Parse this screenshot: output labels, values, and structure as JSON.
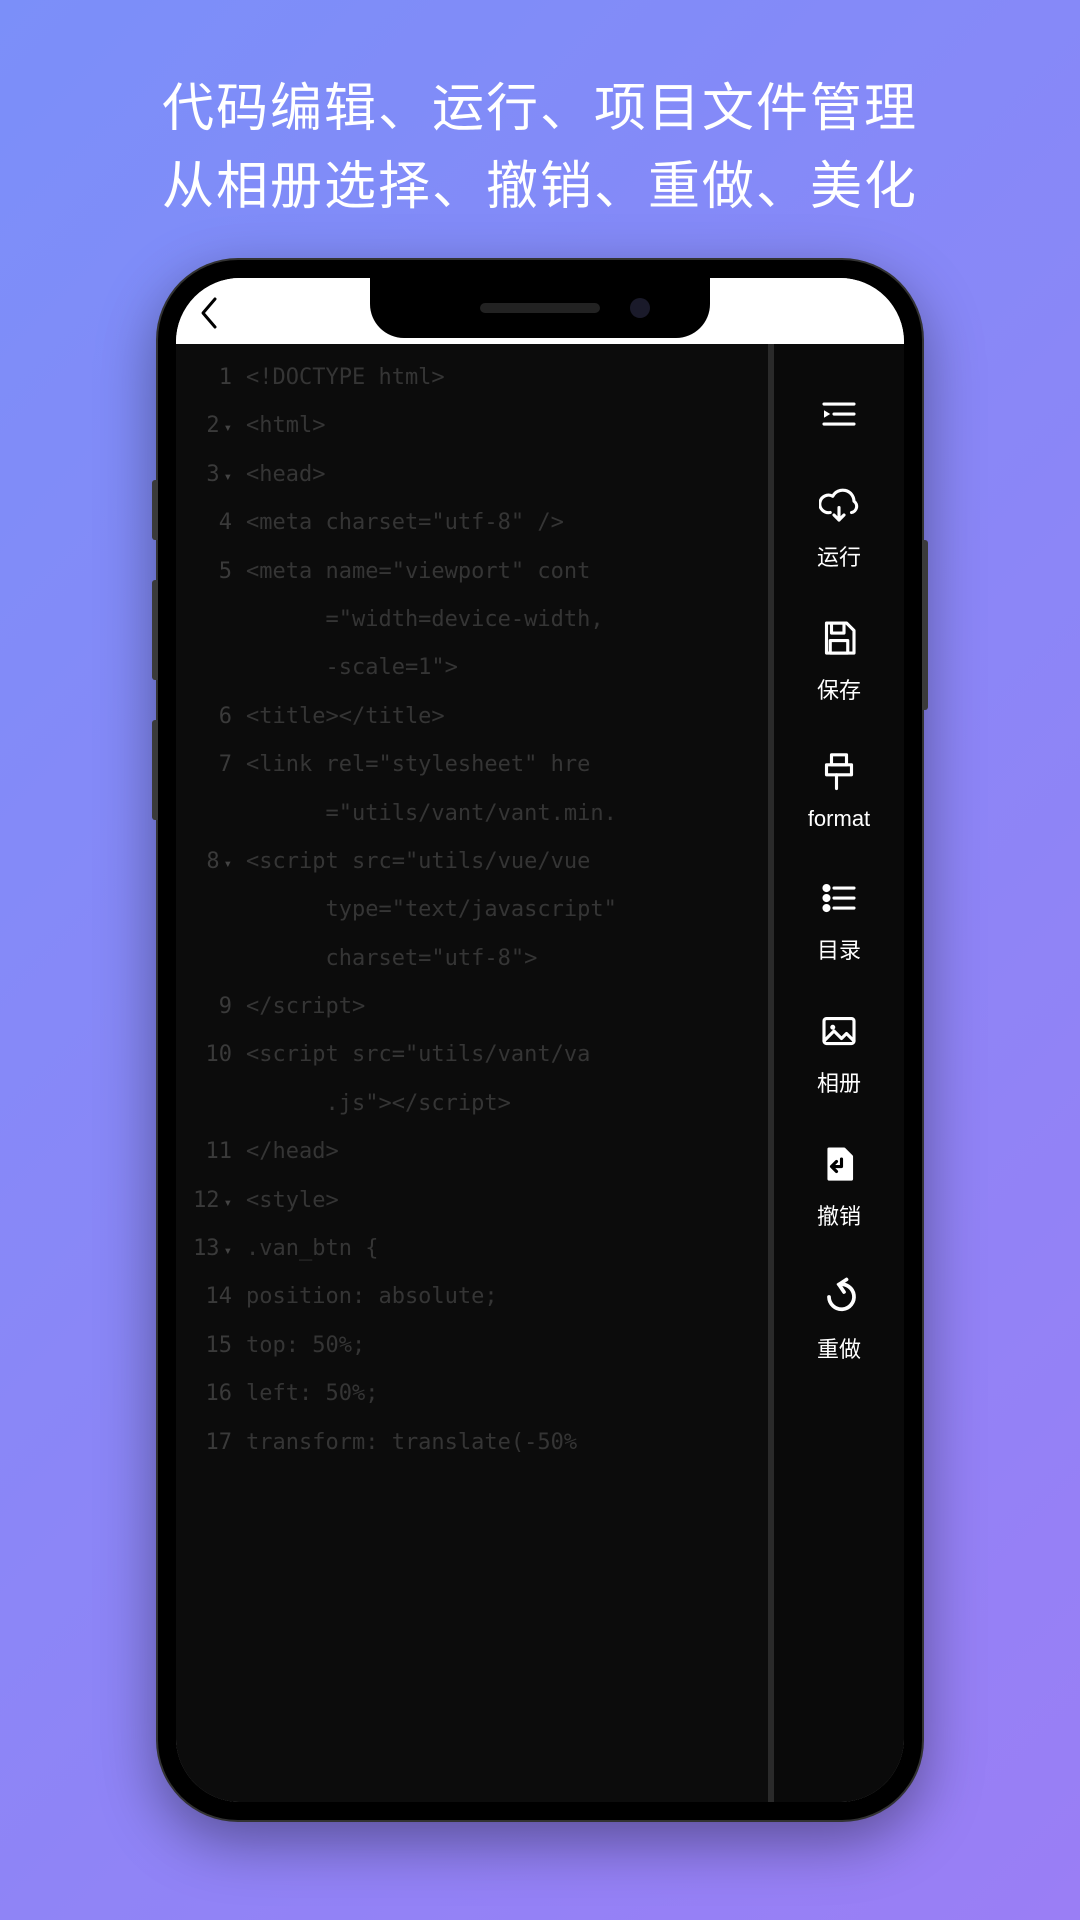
{
  "headline": {
    "line1": "代码编辑、运行、项目文件管理",
    "line2": "从相册选择、撤销、重做、美化"
  },
  "editor": {
    "error_line": 12,
    "lines": [
      {
        "n": 1,
        "fold": false,
        "text": "<!DOCTYPE html>"
      },
      {
        "n": 2,
        "fold": true,
        "text": "<html>"
      },
      {
        "n": 3,
        "fold": true,
        "text": "<head>"
      },
      {
        "n": 4,
        "fold": false,
        "text": "<meta charset=\"utf-8\" />"
      },
      {
        "n": 5,
        "fold": false,
        "text": "<meta name=\"viewport\" cont"
      },
      {
        "n": 0,
        "fold": false,
        "text": "      =\"width=device-width,"
      },
      {
        "n": 0,
        "fold": false,
        "text": "      -scale=1\">"
      },
      {
        "n": 6,
        "fold": false,
        "text": "<title></title>"
      },
      {
        "n": 7,
        "fold": false,
        "text": "<link rel=\"stylesheet\" hre"
      },
      {
        "n": 0,
        "fold": false,
        "text": "      =\"utils/vant/vant.min."
      },
      {
        "n": 8,
        "fold": true,
        "text": "<script src=\"utils/vue/vue"
      },
      {
        "n": 0,
        "fold": false,
        "text": "      type=\"text/javascript\""
      },
      {
        "n": 0,
        "fold": false,
        "text": "      charset=\"utf-8\">"
      },
      {
        "n": 9,
        "fold": false,
        "text": "</script>"
      },
      {
        "n": 10,
        "fold": false,
        "text": "<script src=\"utils/vant/va"
      },
      {
        "n": 0,
        "fold": false,
        "text": "      .js\"></script>"
      },
      {
        "n": 11,
        "fold": false,
        "text": "</head>"
      },
      {
        "n": 12,
        "fold": true,
        "text": "<style>"
      },
      {
        "n": 13,
        "fold": true,
        "text": ".van_btn {"
      },
      {
        "n": 14,
        "fold": false,
        "text": "position: absolute;"
      },
      {
        "n": 15,
        "fold": false,
        "text": "top: 50%;"
      },
      {
        "n": 16,
        "fold": false,
        "text": "left: 50%;"
      },
      {
        "n": 17,
        "fold": false,
        "text": "transform: translate(-50%"
      }
    ]
  },
  "sidepanel": {
    "menu": {
      "label": ""
    },
    "run": {
      "label": "运行"
    },
    "save": {
      "label": "保存"
    },
    "format": {
      "label": "format"
    },
    "toc": {
      "label": "目录"
    },
    "album": {
      "label": "相册"
    },
    "undo": {
      "label": "撤销"
    },
    "redo": {
      "label": "重做"
    }
  }
}
